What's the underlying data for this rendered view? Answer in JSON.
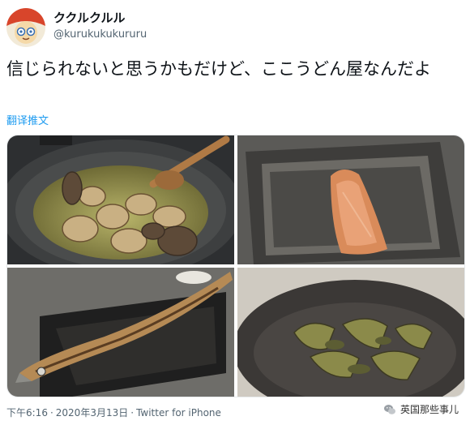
{
  "user": {
    "display_name": "ククルクルル",
    "handle": "@kurukukukururu",
    "avatar_icon": "cartoon-face-avatar"
  },
  "tweet": {
    "text": "信じられないと思うかもだけど、ここうどん屋なんだよ",
    "translate_label": "翻译推文"
  },
  "media": {
    "photos": [
      {
        "name": "clam-soup-photo"
      },
      {
        "name": "grilled-salmon-photo"
      },
      {
        "name": "grilled-saury-photo"
      },
      {
        "name": "stir-fried-vegetables-photo"
      }
    ]
  },
  "meta": {
    "time": "下午6:16",
    "date": "2020年3月13日",
    "separator": "·",
    "source": "Twitter for iPhone"
  },
  "watermark": {
    "text": "英国那些事儿",
    "icon": "wechat-icon"
  },
  "colors": {
    "link": "#1d9bf0",
    "secondary_text": "#536471",
    "primary_text": "#0f1419"
  }
}
